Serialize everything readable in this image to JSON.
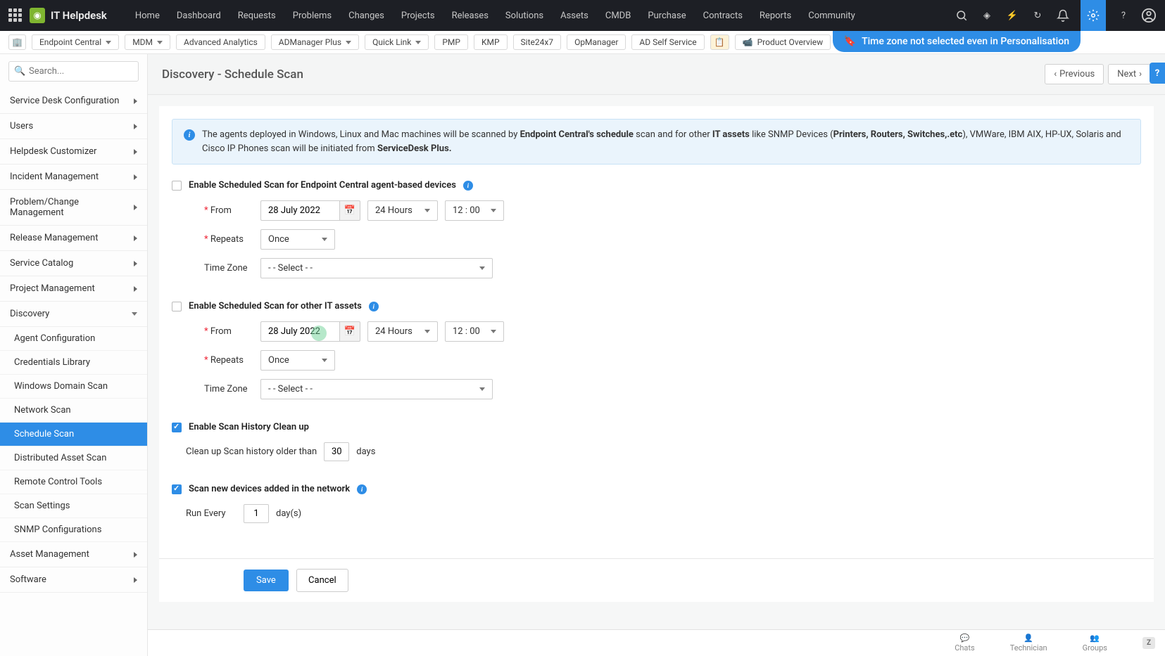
{
  "brand": "IT Helpdesk",
  "topnav": [
    "Home",
    "Dashboard",
    "Requests",
    "Problems",
    "Changes",
    "Projects",
    "Releases",
    "Solutions",
    "Assets",
    "CMDB",
    "Purchase",
    "Contracts",
    "Reports",
    "Community"
  ],
  "secbar": {
    "items": [
      "Endpoint Central",
      "MDM",
      "Advanced Analytics",
      "ADManager Plus",
      "Quick Link",
      "PMP",
      "KMP",
      "Site24x7",
      "OpManager",
      "AD Self Service"
    ],
    "product_overview": "Product Overview"
  },
  "tz_banner": "Time zone not selected even in Personalisation",
  "search_placeholder": "Search...",
  "sidebar_groups": [
    "Service Desk Configuration",
    "Users",
    "Helpdesk Customizer",
    "Incident Management",
    "Problem/Change Management",
    "Release Management",
    "Service Catalog",
    "Project Management"
  ],
  "discovery_label": "Discovery",
  "discovery_items": [
    "Agent Configuration",
    "Credentials Library",
    "Windows Domain Scan",
    "Network Scan",
    "Schedule Scan",
    "Distributed Asset Scan",
    "Remote Control Tools",
    "Scan Settings",
    "SNMP Configurations"
  ],
  "sidebar_groups_after": [
    "Asset Management",
    "Software"
  ],
  "page_title": "Discovery - Schedule Scan",
  "prev": "Previous",
  "next": "Next",
  "info_text_1": "The agents deployed in Windows, Linux and Mac machines will be scanned by ",
  "info_bold_1": "Endpoint Central's schedule",
  "info_text_2": " scan and for other ",
  "info_bold_2": "IT assets",
  "info_text_3": " like SNMP Devices (",
  "info_bold_3": "Printers, Routers, Switches,.etc",
  "info_text_4": "), VMWare, IBM AIX, HP-UX, Solaris and Cisco IP Phones scan will be initiated from ",
  "info_bold_4": "ServiceDesk Plus.",
  "sec1": {
    "title": "Enable Scheduled Scan for Endpoint Central agent-based devices",
    "from": "From",
    "date": "28 July 2022",
    "fmt": "24 Hours",
    "time": "12 : 00",
    "repeats_lbl": "Repeats",
    "repeats": "Once",
    "tz_lbl": "Time Zone",
    "tz": "- - Select - -"
  },
  "sec2": {
    "title": "Enable Scheduled Scan for other IT assets",
    "from": "From",
    "date": "28 July 2022",
    "fmt": "24 Hours",
    "time": "12 : 00",
    "repeats_lbl": "Repeats",
    "repeats": "Once",
    "tz_lbl": "Time Zone",
    "tz": "- - Select - -"
  },
  "cleanup": {
    "title": "Enable Scan History Clean up",
    "label_pre": "Clean up Scan history older than",
    "val": "30",
    "unit": "days"
  },
  "newdev": {
    "title": "Scan new devices added in the network",
    "label": "Run Every",
    "val": "1",
    "unit": "day(s)"
  },
  "save": "Save",
  "cancel": "Cancel",
  "bottombar": [
    "Chats",
    "Technician",
    "Groups"
  ]
}
